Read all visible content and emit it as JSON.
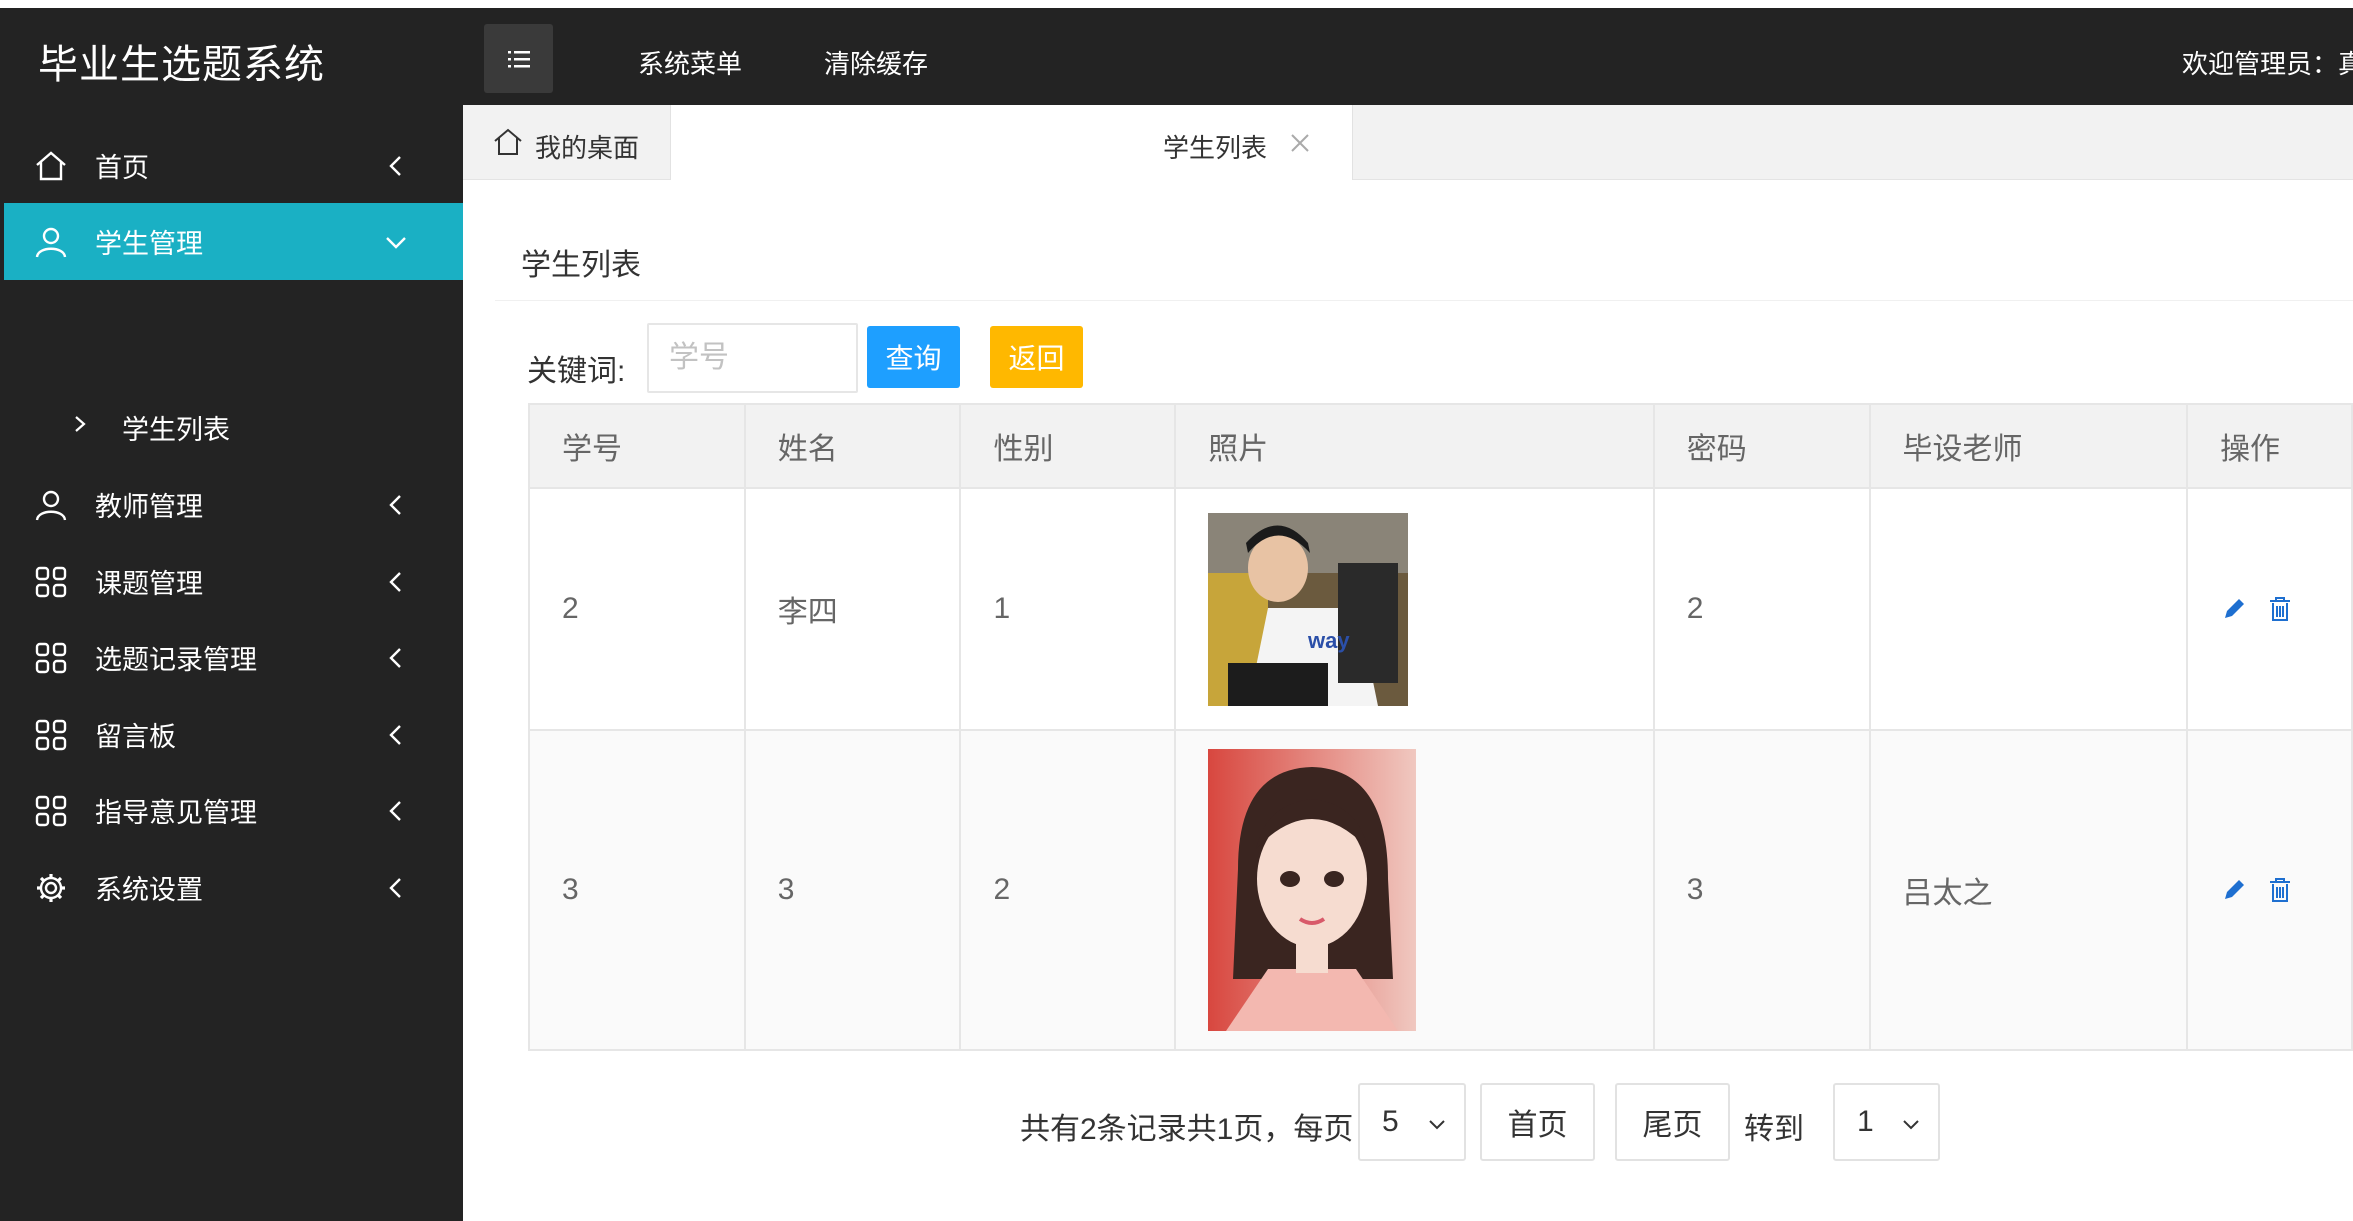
{
  "app": {
    "title": "毕业生选题系统"
  },
  "topnav": {
    "items": [
      "系统菜单",
      "清除缓存"
    ],
    "welcome": "欢迎管理员：真"
  },
  "sidebar": {
    "items": [
      {
        "label": "首页",
        "icon": "home-icon"
      },
      {
        "label": "学生管理",
        "icon": "user-icon",
        "active": true
      },
      {
        "label": "教师管理",
        "icon": "user-icon"
      },
      {
        "label": "课题管理",
        "icon": "grid-icon"
      },
      {
        "label": "选题记录管理",
        "icon": "grid-icon"
      },
      {
        "label": "留言板",
        "icon": "grid-icon"
      },
      {
        "label": "指导意见管理",
        "icon": "grid-icon"
      },
      {
        "label": "系统设置",
        "icon": "gear-icon"
      }
    ],
    "sub_item": "学生列表"
  },
  "tabs": {
    "home": "我的桌面",
    "active": "学生列表"
  },
  "page": {
    "title": "学生列表"
  },
  "search": {
    "label": "关键词:",
    "placeholder": "学号",
    "value": "",
    "search_button": "查询",
    "back_button": "返回"
  },
  "table": {
    "headers": [
      "学号",
      "姓名",
      "性别",
      "照片",
      "密码",
      "毕设老师",
      "操作"
    ],
    "rows": [
      {
        "id": "2",
        "name": "李四",
        "gender": "1",
        "password": "2",
        "teacher": ""
      },
      {
        "id": "3",
        "name": "3",
        "gender": "2",
        "password": "3",
        "teacher": "吕太之"
      }
    ]
  },
  "pagination": {
    "summary": "共有2条记录共1页，每页",
    "page_size": "5",
    "first": "首页",
    "last": "尾页",
    "goto_label": "转到",
    "goto_value": "1"
  },
  "colors": {
    "sidebar_bg": "#232323",
    "active": "#1ab0c4",
    "primary": "#1e9fff",
    "warning": "#ffb800"
  }
}
